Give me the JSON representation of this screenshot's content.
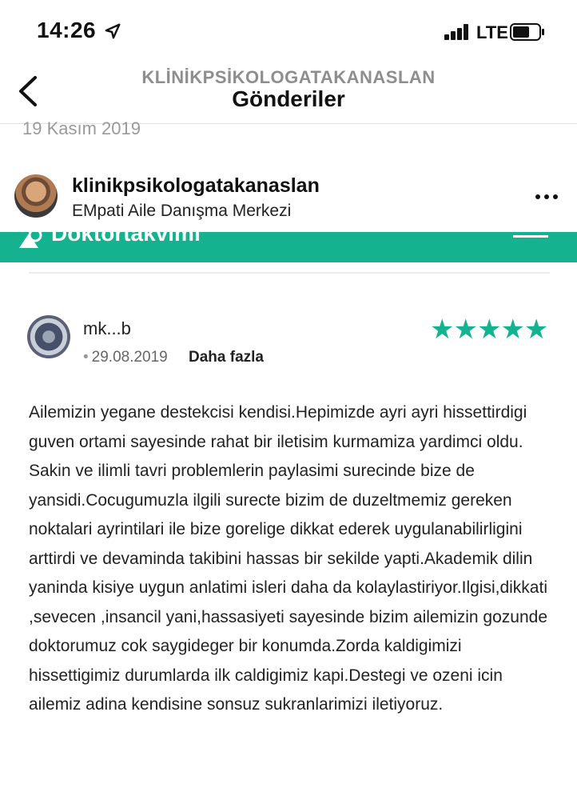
{
  "status_bar": {
    "time": "14:26",
    "network": "LTE",
    "signal_bars": 4,
    "icons": [
      "location-arrow-icon",
      "signal-icon",
      "battery-icon"
    ]
  },
  "nav": {
    "account": "KLİNİKPSİKOLOGATAKANASLAN",
    "title": "Gönderiler",
    "back_icon": "chevron-left-icon"
  },
  "post": {
    "date": "19 Kasım 2019",
    "username": "klinikpsikologatakanaslan",
    "location": "EMpati Aile Danışma Merkezi",
    "more_icon": "ellipsis-icon"
  },
  "image": {
    "banner_text": "Doktortakvimi",
    "accent_color": "#14b28e",
    "review": {
      "reviewer": "mk...b",
      "date": "29.08.2019",
      "more_label": "Daha fazla",
      "stars": "★★★★★",
      "rating": 5,
      "text": "Ailemizin yegane destekcisi kendisi.Hepimizde ayri ayri hissettirdigi guven ortami sayesinde rahat bir iletisim kurmamiza yardimci oldu. Sakin ve ilimli tavri problemlerin paylasimi surecinde bize de yansidi.Cocugumuzla ilgili surecte bizim de duzeltmemiz gereken noktalari ayrintilari ile bize gorelige dikkat ederek uygulanabilirligini arttirdi ve devaminda takibini hassas bir sekilde yapti.Akademik dilin yaninda kisiye uygun anlatimi isleri daha da kolaylastiriyor.Ilgisi,dikkati ,sevecen ,insancil yani,hassasiyeti sayesinde bizim ailemizin gozunde doktorumuz cok saygideger bir konumda.Zorda kaldigimizi hissettigimiz durumlarda ilk caldigimiz kapi.Destegi ve ozeni icin ailemiz adina kendisine sonsuz sukranlarimizi iletiyoruz."
    }
  }
}
